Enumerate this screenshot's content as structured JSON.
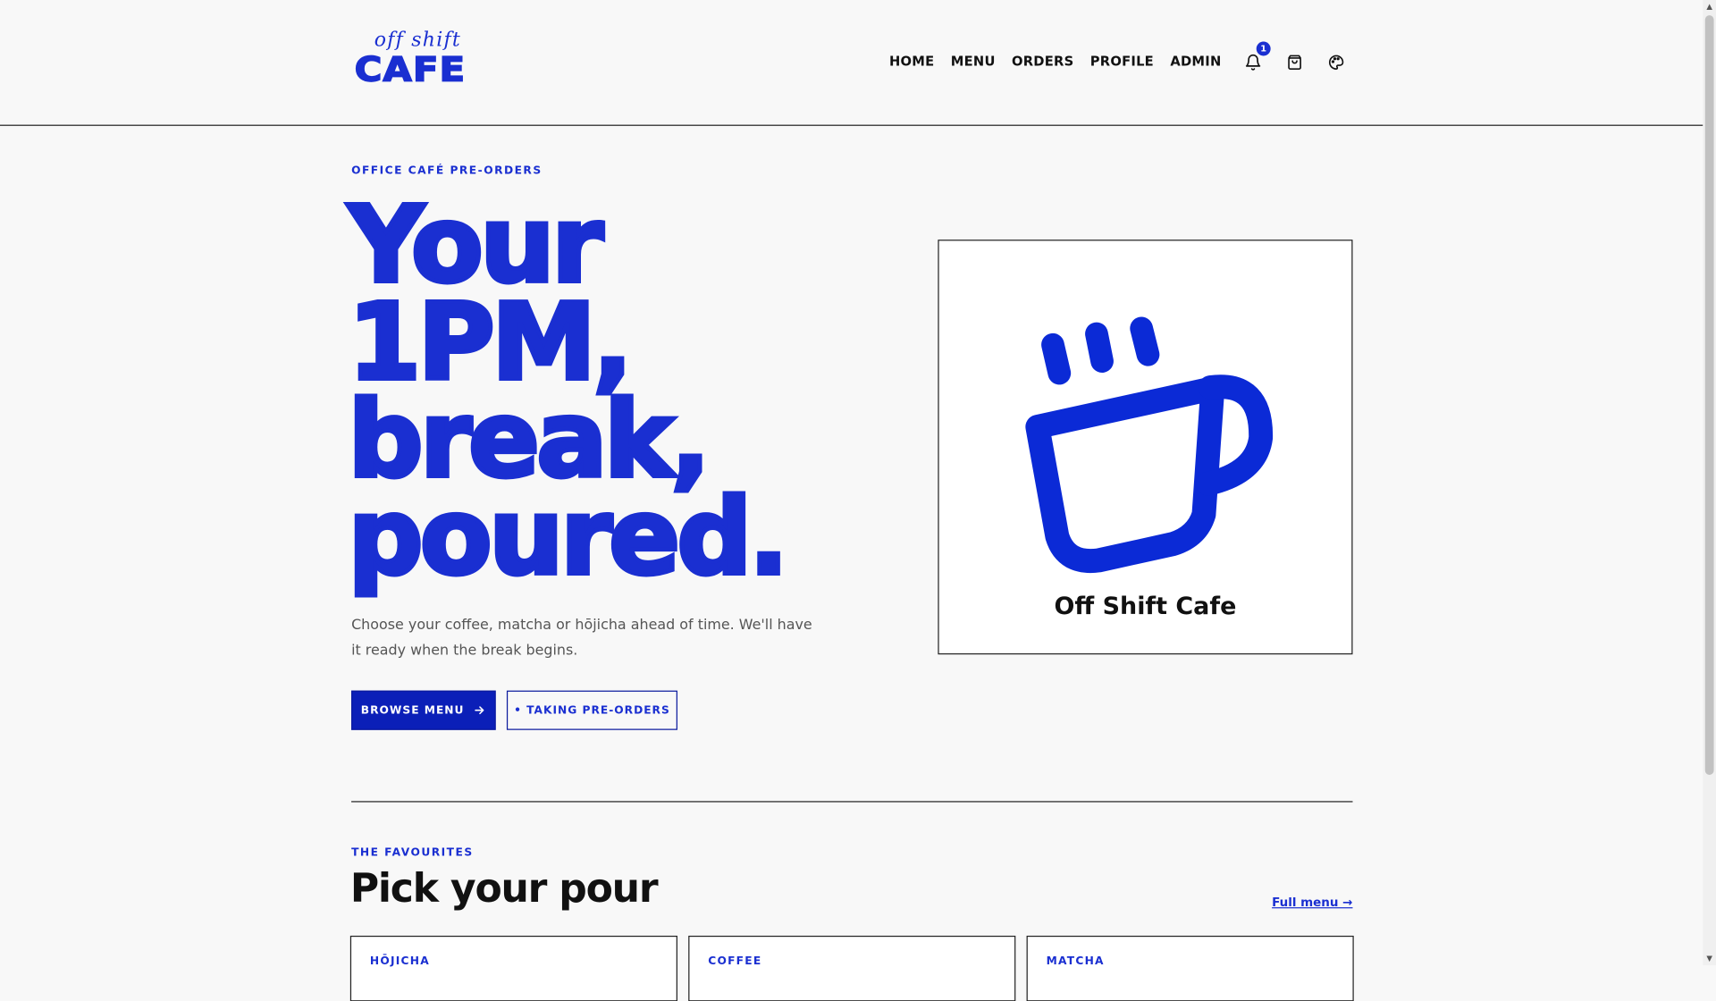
{
  "brand": {
    "small": "off shift",
    "big": "CAFE",
    "color": "#1a2fd1"
  },
  "nav": {
    "items": [
      "HOME",
      "MENU",
      "ORDERS",
      "PROFILE",
      "ADMIN"
    ],
    "notifications_count": "1",
    "icons": [
      "bell-icon",
      "cart-icon",
      "palette-icon"
    ]
  },
  "hero": {
    "eyebrow": "OFFICE CAFÉ PRE-ORDERS",
    "title_lines": [
      "Your",
      "1PM,",
      "break,",
      "poured."
    ],
    "subtitle": "Choose your coffee, matcha or hōjicha ahead of time. We'll have it ready when the break begins.",
    "primary_button": "BROWSE MENU",
    "secondary_button": "• TAKING PRE-ORDERS",
    "card_caption": "Off Shift Cafe"
  },
  "favourites": {
    "eyebrow": "THE FAVOURITES",
    "title": "Pick your pour",
    "full_menu_link": "Full menu →",
    "cards": [
      "HŌJICHA",
      "COFFEE",
      "MATCHA"
    ]
  }
}
